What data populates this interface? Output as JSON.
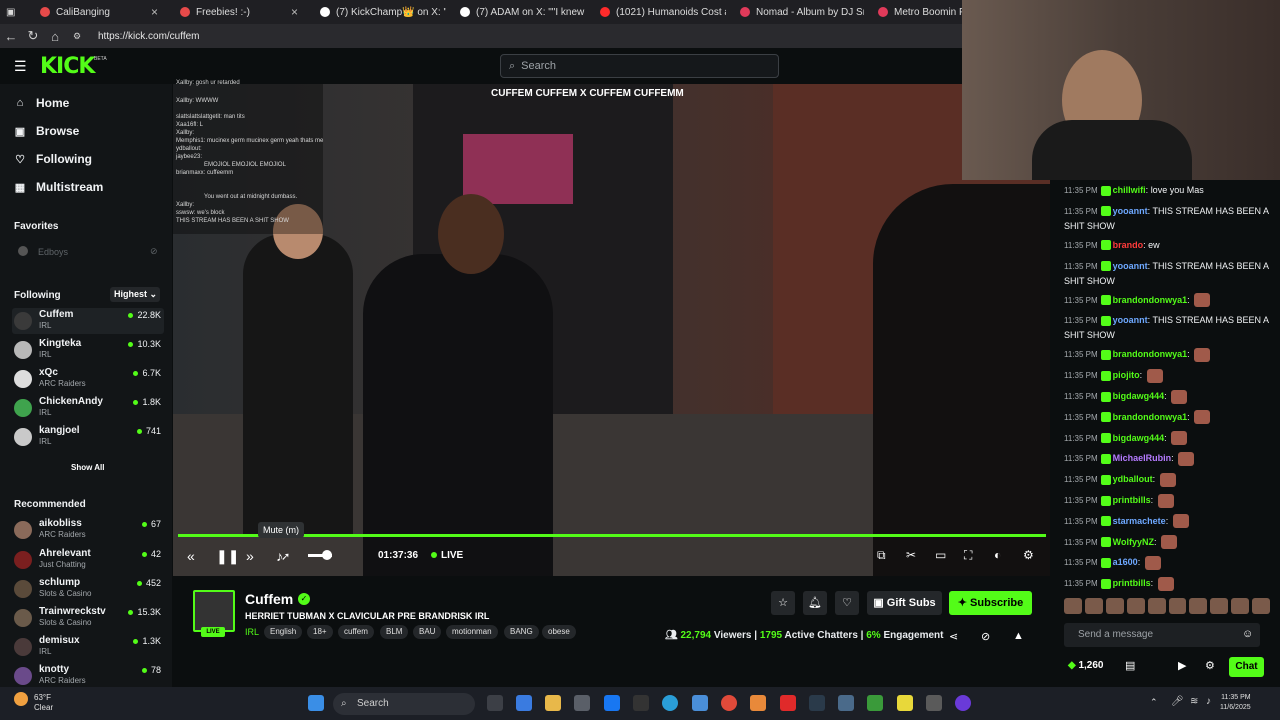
{
  "browser": {
    "tabs": [
      {
        "label": "CaliBanging",
        "color": "#e64a4a"
      },
      {
        "label": "Freebies! :-)",
        "color": "#e64a4a"
      },
      {
        "label": "(7) KickChamp👑 on X: \"A s",
        "color": "#ffffff"
      },
      {
        "label": "(7) ADAM on X: \"\"I knew pe",
        "color": "#ffffff"
      },
      {
        "label": "(1021) Humanoids Cost as M",
        "color": "#ff2b2b"
      },
      {
        "label": "Nomad - Album by DJ Snak",
        "color": "#e03a5a"
      },
      {
        "label": "Metro Boomin Present",
        "color": "#e03a5a"
      }
    ],
    "url": "https://kick.com/cuffem"
  },
  "header": {
    "logo": "KICK",
    "beta": "BETA",
    "search_placeholder": "Search"
  },
  "sidebar": {
    "nav": [
      {
        "label": "Home",
        "icon": "home-icon",
        "glyph": "⌂"
      },
      {
        "label": "Browse",
        "icon": "browse-icon",
        "glyph": "▣"
      },
      {
        "label": "Following",
        "icon": "heart-icon",
        "glyph": "♡"
      },
      {
        "label": "Multistream",
        "icon": "grid-icon",
        "glyph": "▦"
      }
    ],
    "favorites_label": "Favorites",
    "favorite_item": "Edboys",
    "following_label": "Following",
    "sort_label": "Highest",
    "following": [
      {
        "name": "Cuffem",
        "category": "IRL",
        "viewers": "22.8K"
      },
      {
        "name": "Kingteka",
        "category": "IRL",
        "viewers": "10.3K"
      },
      {
        "name": "xQc",
        "category": "ARC Raiders",
        "viewers": "6.7K"
      },
      {
        "name": "ChickenAndy",
        "category": "IRL",
        "viewers": "1.8K"
      },
      {
        "name": "kangjoel",
        "category": "IRL",
        "viewers": "741"
      }
    ],
    "show_all": "Show All",
    "recommended_label": "Recommended",
    "recommended": [
      {
        "name": "aikobliss",
        "category": "ARC Raiders",
        "viewers": "67"
      },
      {
        "name": "Ahrelevant",
        "category": "Just Chatting",
        "viewers": "42"
      },
      {
        "name": "schlump",
        "category": "Slots & Casino",
        "viewers": "452"
      },
      {
        "name": "Trainwreckstv",
        "category": "Slots & Casino",
        "viewers": "15.3K"
      },
      {
        "name": "demisux",
        "category": "IRL",
        "viewers": "1.3K"
      },
      {
        "name": "knotty",
        "category": "ARC Raiders",
        "viewers": "78"
      }
    ]
  },
  "video": {
    "banner": "CUFFEM  CUFFEM  X  CUFFEM  CUFFEMM",
    "overlay_chat": [
      "Xallby: gosh ur retarded",
      "Xallby: WWWW",
      "slattslattslattgetit: man tits",
      "Xaa16fl: L",
      "Xallby:",
      "Memphis1: mucinex germ mucinex germ yeah thats me",
      "ydballout:",
      "jaybee23:",
      "EMOJIOL EMOJIOL EMOJIOL",
      "brianmaxx: cuffeemm",
      "You went out at midnight dumbass.",
      "Xallby:",
      "sswsw: we's block",
      "THIS STREAM HAS BEEN A SHIT SHOW"
    ],
    "tooltip": "Mute (m)",
    "time": "01:37:36",
    "live": "LIVE",
    "progress": 1.0,
    "volume": 0.6
  },
  "stream": {
    "name": "Cuffem",
    "live_badge": "LIVE",
    "title": "HERRIET TUBMAN X CLAVICULAR PRE BRANDRISK IRL",
    "category": "IRL",
    "tags": [
      "English",
      "18+",
      "cuffem",
      "BLM",
      "BAU",
      "motionman",
      "BANG",
      "obese"
    ],
    "gift_label": "Gift Subs",
    "subscribe_label": "Subscribe",
    "viewers": "22,794",
    "viewers_label": "Viewers",
    "chatters": "1795",
    "chatters_label": "Active Chatters",
    "engagement": "6%",
    "engagement_label": "Engagement"
  },
  "chat": {
    "messages": [
      {
        "time": "11:35 PM",
        "user": "chillwifi",
        "color": "#53fc18",
        "text": "love you Mas",
        "emote": false
      },
      {
        "time": "11:35 PM",
        "user": "yooannt",
        "color": "#6ea8ff",
        "text": "THIS STREAM HAS BEEN A SHIT SHOW",
        "emote": false
      },
      {
        "time": "11:35 PM",
        "user": "brando",
        "color": "#ff3b3b",
        "text": "ew",
        "emote": false
      },
      {
        "time": "11:35 PM",
        "user": "yooannt",
        "color": "#6ea8ff",
        "text": "THIS STREAM HAS BEEN A SHIT SHOW",
        "emote": false
      },
      {
        "time": "11:35 PM",
        "user": "brandondonwya1",
        "color": "#53fc18",
        "text": "",
        "emote": true
      },
      {
        "time": "11:35 PM",
        "user": "yooannt",
        "color": "#6ea8ff",
        "text": "THIS STREAM HAS BEEN A SHIT SHOW",
        "emote": false
      },
      {
        "time": "11:35 PM",
        "user": "brandondonwya1",
        "color": "#53fc18",
        "text": "",
        "emote": true
      },
      {
        "time": "11:35 PM",
        "user": "piojito",
        "color": "#53fc18",
        "text": "",
        "emote": true
      },
      {
        "time": "11:35 PM",
        "user": "bigdawg444",
        "color": "#53fc18",
        "text": "",
        "emote": true
      },
      {
        "time": "11:35 PM",
        "user": "brandondonwya1",
        "color": "#53fc18",
        "text": "",
        "emote": true
      },
      {
        "time": "11:35 PM",
        "user": "bigdawg444",
        "color": "#53fc18",
        "text": "",
        "emote": true
      },
      {
        "time": "11:35 PM",
        "user": "MichaelRubin",
        "color": "#b57bff",
        "text": "",
        "emote": true
      },
      {
        "time": "11:35 PM",
        "user": "ydballout",
        "color": "#53fc18",
        "text": "",
        "emote": true
      },
      {
        "time": "11:35 PM",
        "user": "printbills",
        "color": "#53fc18",
        "text": "",
        "emote": true
      },
      {
        "time": "11:35 PM",
        "user": "starmachete",
        "color": "#6ea8ff",
        "text": "",
        "emote": true
      },
      {
        "time": "11:35 PM",
        "user": "WolfyyNZ",
        "color": "#53fc18",
        "text": "",
        "emote": true
      },
      {
        "time": "11:35 PM",
        "user": "a1600",
        "color": "#6ea8ff",
        "text": "",
        "emote": true
      },
      {
        "time": "11:35 PM",
        "user": "printbills",
        "color": "#53fc18",
        "text": "",
        "emote": true
      }
    ],
    "input_placeholder": "Send a message",
    "points": "1,260",
    "chat_button": "Chat"
  },
  "taskbar": {
    "temp": "63°F",
    "weather": "Clear",
    "search": "Search",
    "time": "11:35 PM",
    "date": "11/6/2025"
  },
  "colors": {
    "accent": "#53fc18",
    "bg": "#0b0e0f",
    "sidebar": "#121517"
  }
}
